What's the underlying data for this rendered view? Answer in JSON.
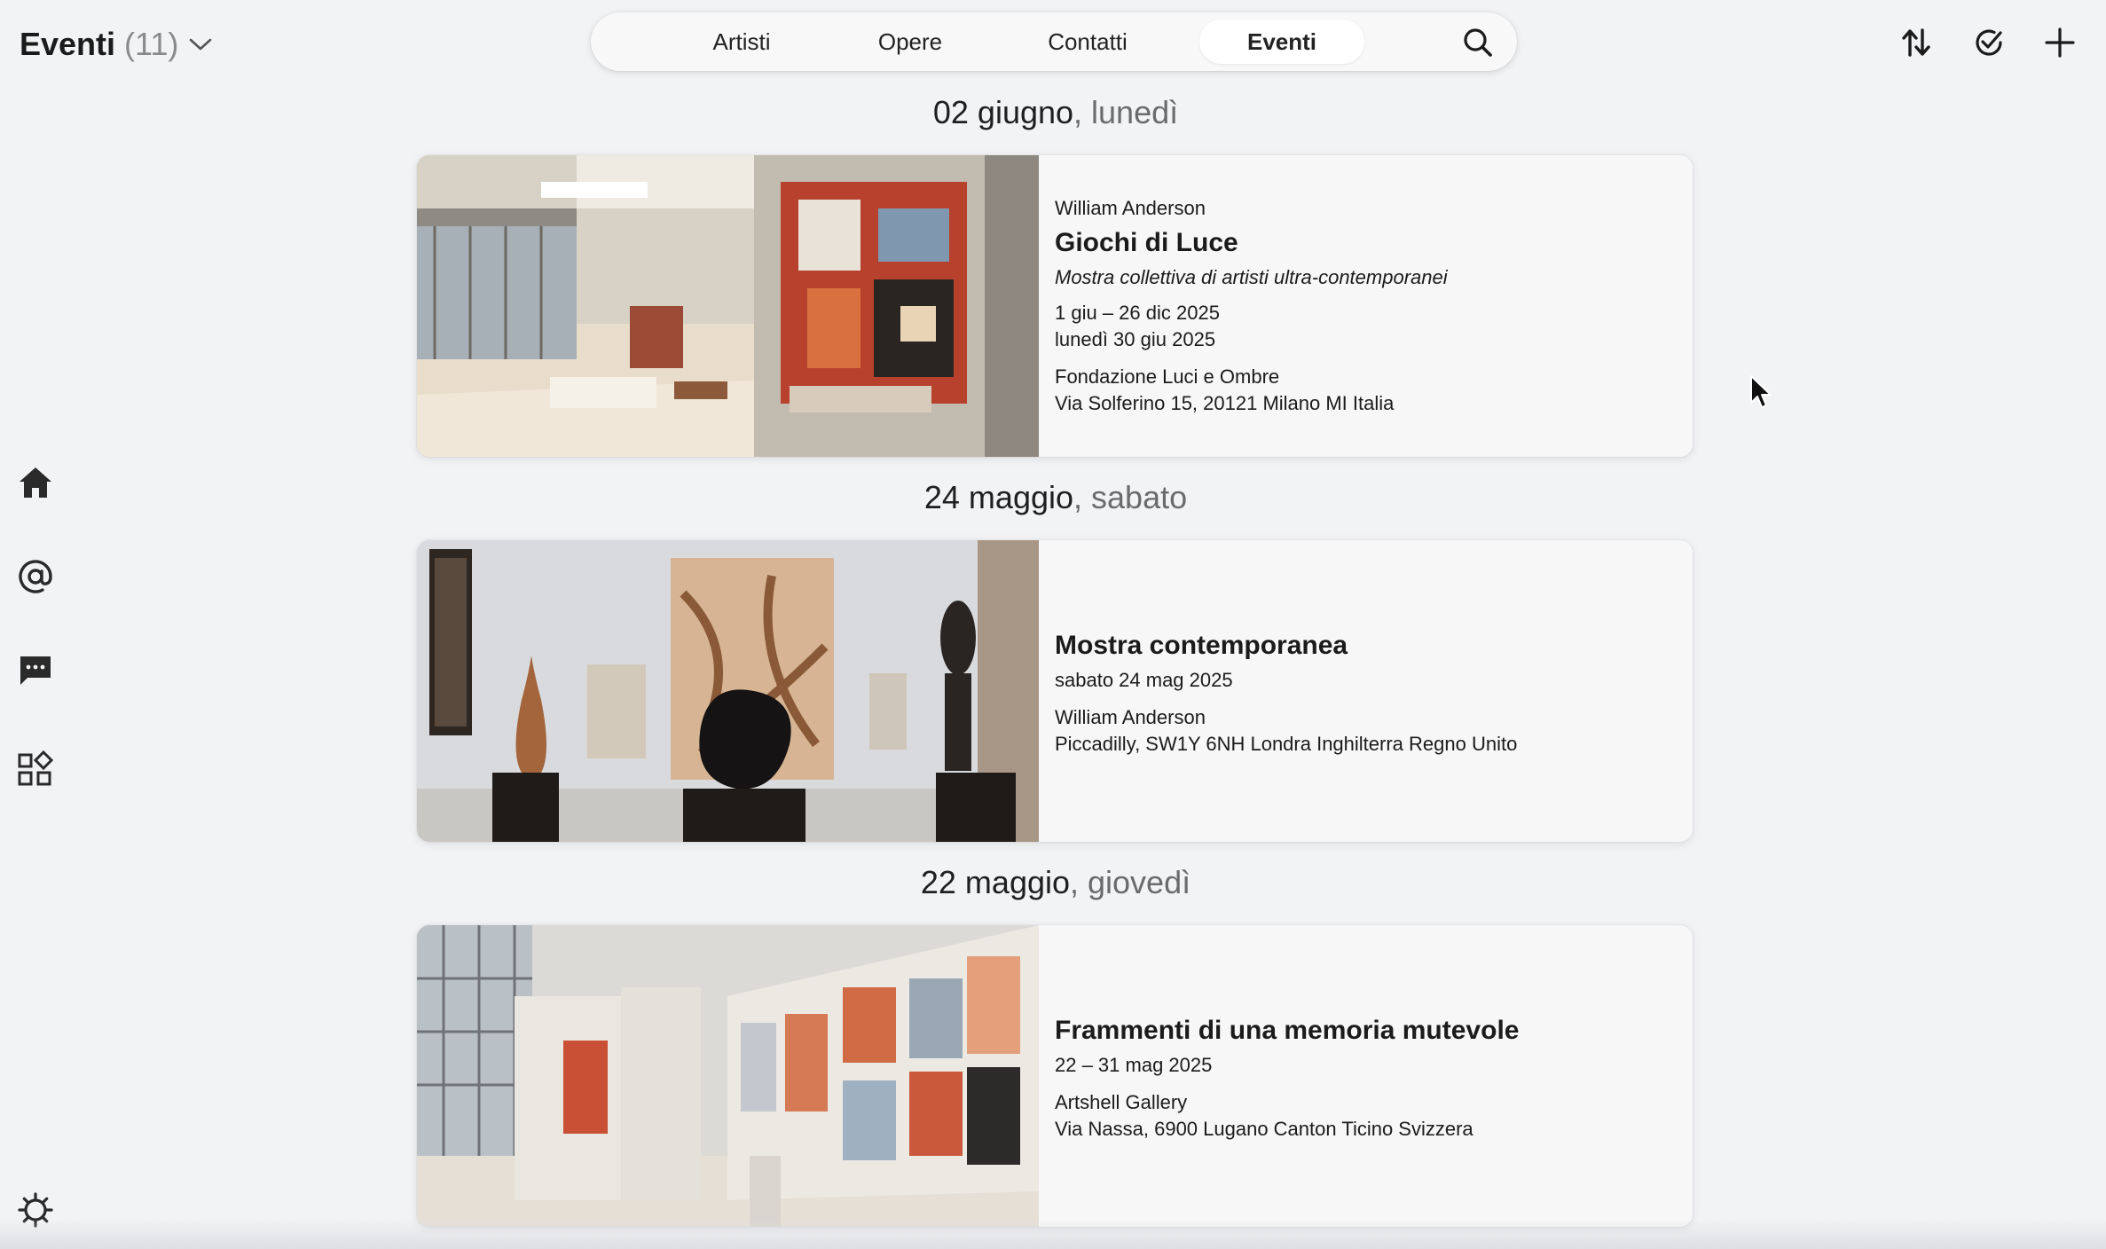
{
  "header": {
    "title": "Eventi",
    "count": "(11)"
  },
  "tabs": [
    {
      "label": "Artisti",
      "active": false
    },
    {
      "label": "Opere",
      "active": false
    },
    {
      "label": "Contatti",
      "active": false
    },
    {
      "label": "Eventi",
      "active": true
    }
  ],
  "icons": {
    "search": "search-icon",
    "sort": "sort-icon",
    "select": "check-circle-icon",
    "add": "plus-icon",
    "nav": [
      "home-icon",
      "at-icon",
      "chat-icon",
      "apps-icon"
    ],
    "settings": "gear-icon"
  },
  "colors": {
    "background": "#f2f3f5",
    "card": "#f7f7f8",
    "text": "#1b1b1b",
    "muted": "#6b6b6b"
  },
  "feed": [
    {
      "date": "02 giugno",
      "weekday": ", lunedì",
      "artist": "William Anderson",
      "title": "Giochi di Luce",
      "subtitle": "Mostra collettiva di artisti ultra-contemporanei",
      "range": "1 giu – 26 dic 2025",
      "day": "lunedì 30 giu 2025",
      "venue": "Fondazione Luci e Ombre",
      "address": "Via Solferino 15, 20121 Milano MI Italia"
    },
    {
      "date": "24 maggio",
      "weekday": ", sabato",
      "title": "Mostra contemporanea",
      "day": "sabato 24 mag 2025",
      "artist": "William Anderson",
      "address": "Piccadilly, SW1Y 6NH Londra Inghilterra Regno Unito"
    },
    {
      "date": "22 maggio",
      "weekday": ", giovedì",
      "title": "Frammenti di una memoria mutevole",
      "range": "22 – 31 mag 2025",
      "venue": "Artshell Gallery",
      "address": "Via Nassa, 6900 Lugano Canton Ticino Svizzera"
    }
  ]
}
